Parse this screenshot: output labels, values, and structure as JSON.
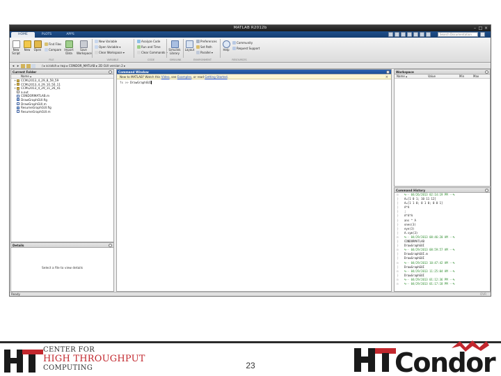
{
  "window": {
    "title": "MATLAB R2012b",
    "tabs": [
      "HOME",
      "PLOTS",
      "APPS"
    ],
    "search_placeholder": "Search Documentation"
  },
  "ribbon": {
    "new_script": [
      "New",
      "Script"
    ],
    "new": "New",
    "open": "Open",
    "find_files": "Find Files",
    "compare": "Compare",
    "import_data": [
      "Import",
      "Data"
    ],
    "save_workspace": [
      "Save",
      "Workspace"
    ],
    "new_variable": "New Variable",
    "open_variable": "Open Variable",
    "clear_workspace": "Clear Workspace",
    "analyze_code": "Analyze Code",
    "run_and_time": "Run and Time",
    "clear_commands": "Clear Commands",
    "simulink_library": [
      "Simulink",
      "Library"
    ],
    "layout": "Layout",
    "preferences": "Preferences",
    "set_path": "Set Path",
    "parallel": "Parallel",
    "help": "Help",
    "community": "Community",
    "request_support": "Request Support",
    "group_labels": [
      "FILE",
      "VARIABLE",
      "CODE",
      "SIMULINK",
      "ENVIRONMENT",
      "RESOURCES"
    ]
  },
  "address": {
    "path": "/ ▸ scratch ▸ rwp ▸ CONDOR_MATLAB ▸ 2D GUI version 2 ▸"
  },
  "current_folder": {
    "title": "Current Folder",
    "column": "Name ▴",
    "items": [
      {
        "name": "CCML2013_4_29_8_59_59",
        "type": "folder"
      },
      {
        "name": "CCML2013_4_29_10_50_11",
        "type": "folder"
      },
      {
        "name": "CCML2013_4_29_11_26_41",
        "type": "folder"
      },
      {
        "name": "a.out",
        "type": "file"
      },
      {
        "name": "CONDORMATLAB.m",
        "type": "mfile"
      },
      {
        "name": "DrawGraphGUI.fig",
        "type": "fig"
      },
      {
        "name": "DrawGraphGUI.m",
        "type": "mfile"
      },
      {
        "name": "ResumeGraphGUI.fig",
        "type": "fig"
      },
      {
        "name": "ResumeGraphGUI.m",
        "type": "mfile"
      }
    ]
  },
  "details": {
    "title": "Details",
    "message": "Select a file to view details"
  },
  "command_window": {
    "title": "Command Window",
    "notice_prefix": "New to MATLAB? Watch this ",
    "notice_link1": "Video",
    "notice_mid1": ", see ",
    "notice_link2": "Examples",
    "notice_mid2": ", or read ",
    "notice_link3": "Getting Started",
    "notice_suffix": ".",
    "prompt": "fx >>",
    "input": "DrawGraphGUI"
  },
  "workspace": {
    "title": "Workspace",
    "columns": [
      "Name ▴",
      "Value",
      "Min",
      "Max"
    ]
  },
  "history": {
    "title": "Command History",
    "rows": [
      {
        "text": "%-- 04/26/2013 02:14:19 PM --%",
        "session": true
      },
      {
        "text": "A=[1 0 1; 10 11 12]",
        "session": false
      },
      {
        "text": "A=[1 1 0; 0 1 0; 0 0 1]",
        "session": false
      },
      {
        "text": "A*A",
        "session": false
      },
      {
        "text": ";",
        "session": false
      },
      {
        "text": "A*A*A",
        "session": false
      },
      {
        "text": "ans ^ A",
        "session": false
      },
      {
        "text": "ones(3)",
        "session": false
      },
      {
        "text": "eye(3)",
        "session": false
      },
      {
        "text": "A.sym(3)",
        "session": false
      },
      {
        "text": "%-- 04/29/2013 08:46:20 AM --%",
        "session": true
      },
      {
        "text": "CONDORMATLAB",
        "session": false
      },
      {
        "text": "DrawGraphGUI",
        "session": false
      },
      {
        "text": "%-- 04/29/2013 08:59:57 AM --%",
        "session": true
      },
      {
        "text": "DrawGraphGUI.m",
        "session": false
      },
      {
        "text": "DrawGraphGUI",
        "session": false
      },
      {
        "text": "%-- 04/29/2013 10:47:42 AM --%",
        "session": true
      },
      {
        "text": "DrawGraphGUI",
        "session": false
      },
      {
        "text": "%-- 04/29/2013 11:25:04 AM --%",
        "session": true
      },
      {
        "text": "DrawGraphGUI",
        "session": false
      },
      {
        "text": "%-- 04/29/2013 01:12:36 PM --%",
        "session": true
      },
      {
        "text": "%-- 04/29/2013 01:17:18 PM --%",
        "session": true
      }
    ]
  },
  "status": {
    "left": "Ready",
    "right": "OVR"
  },
  "footer": {
    "center_line1": "CENTER FOR",
    "center_line2": "HIGH THROUGHPUT",
    "center_line3": "COMPUTING",
    "page_number": "23",
    "brand_colors": {
      "dark": "#1a1a1a",
      "red": "#c2272d"
    }
  }
}
